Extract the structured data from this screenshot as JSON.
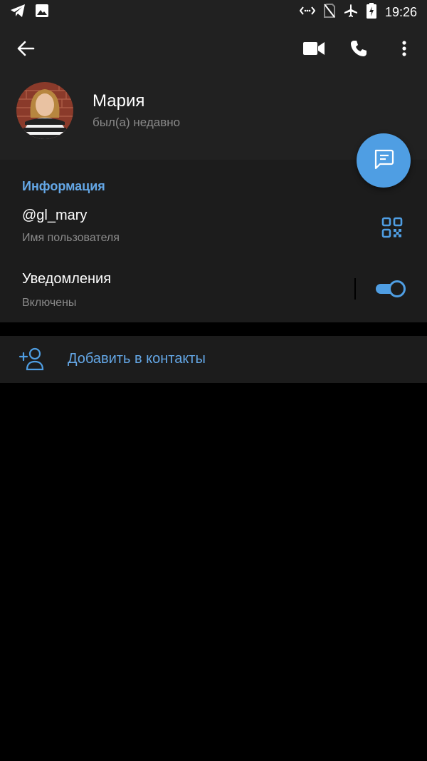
{
  "status_bar": {
    "time": "19:26",
    "left_icons": [
      "telegram-icon",
      "image-icon"
    ],
    "right_icons": [
      "data-saver-icon",
      "no-sim-icon",
      "airplane-icon",
      "battery-charging-icon"
    ]
  },
  "toolbar": {
    "back_icon": "arrow-left-icon",
    "actions": [
      "video-call-icon",
      "phone-icon",
      "more-vertical-icon"
    ]
  },
  "profile": {
    "name": "Мария",
    "status": "был(а) недавно"
  },
  "fab": {
    "icon": "message-icon"
  },
  "info_section": {
    "title": "Информация",
    "username": "@gl_mary",
    "username_label": "Имя пользователя",
    "qr_icon": "qr-code-icon",
    "notifications_label": "Уведомления",
    "notifications_status": "Включены",
    "notifications_enabled": true
  },
  "add_contact": {
    "icon": "add-user-icon",
    "label": "Добавить в контакты"
  },
  "colors": {
    "accent": "#4f9ee3",
    "accent_text": "#64a7e6",
    "header_bg": "#212121",
    "section_bg": "#1c1c1c",
    "secondary_text": "#8a8a8a"
  }
}
